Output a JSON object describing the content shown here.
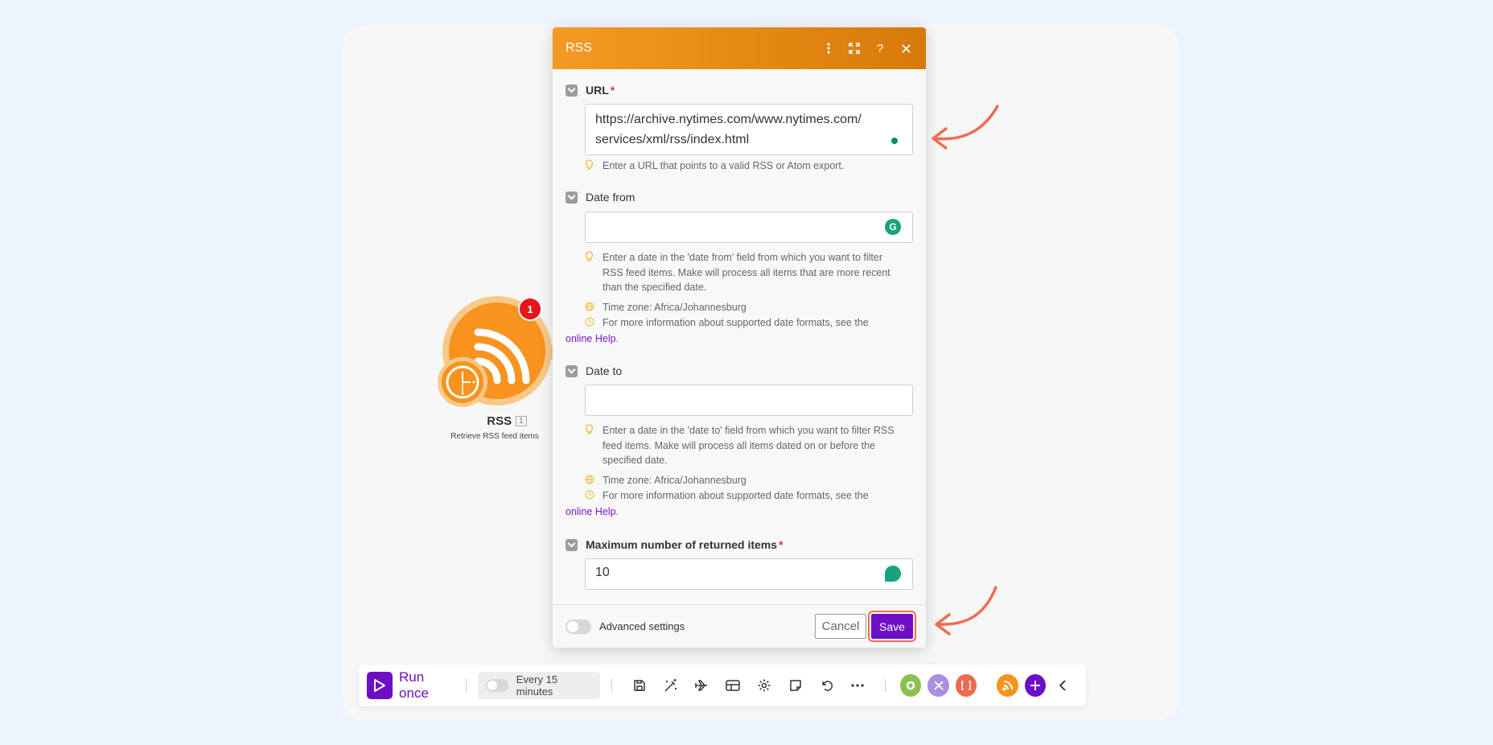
{
  "dialog": {
    "title": "RSS",
    "fields": {
      "url": {
        "label": "URL",
        "required_mark": "*",
        "value_line1": "https://archive.nytimes.com/www.nytimes.com/",
        "value_line2": "services/xml/rss/index.html",
        "hint": "Enter a URL that points to a valid RSS or Atom export."
      },
      "date_from": {
        "label": "Date from",
        "value": "",
        "hint_line1": "Enter a date in the 'date from' field from which you want to filter",
        "hint_line2": "RSS feed items. Make will process all items that are more recent",
        "hint_line3": "than the specified date.",
        "timezone": "Time zone: Africa/Johannesburg",
        "info": "For more information about supported date formats, see the",
        "link": "online Help",
        "link_after": "."
      },
      "date_to": {
        "label": "Date to",
        "value": "",
        "hint_line1": "Enter a date in the 'date to' field from which you want to filter RSS",
        "hint_line2": "feed items. Make will process all items dated on or before the",
        "hint_line3": "specified date.",
        "timezone": "Time zone: Africa/Johannesburg",
        "info": "For more information about supported date formats, see the",
        "link": "online Help",
        "link_after": "."
      },
      "max_items": {
        "label": "Maximum number of returned items",
        "required_mark": "*",
        "value": "10"
      }
    },
    "footer": {
      "advanced_label": "Advanced settings",
      "cancel_label": "Cancel",
      "save_label": "Save"
    }
  },
  "module": {
    "title": "RSS",
    "number": "1",
    "subtitle": "Retrieve RSS feed items",
    "badge": "1"
  },
  "toolbar": {
    "run_label": "Run once",
    "schedule_label": "Every 15 minutes"
  },
  "colors": {
    "accent": "#6d0fc5",
    "rss_orange": "#f7931e",
    "arrow": "#f26b50"
  }
}
